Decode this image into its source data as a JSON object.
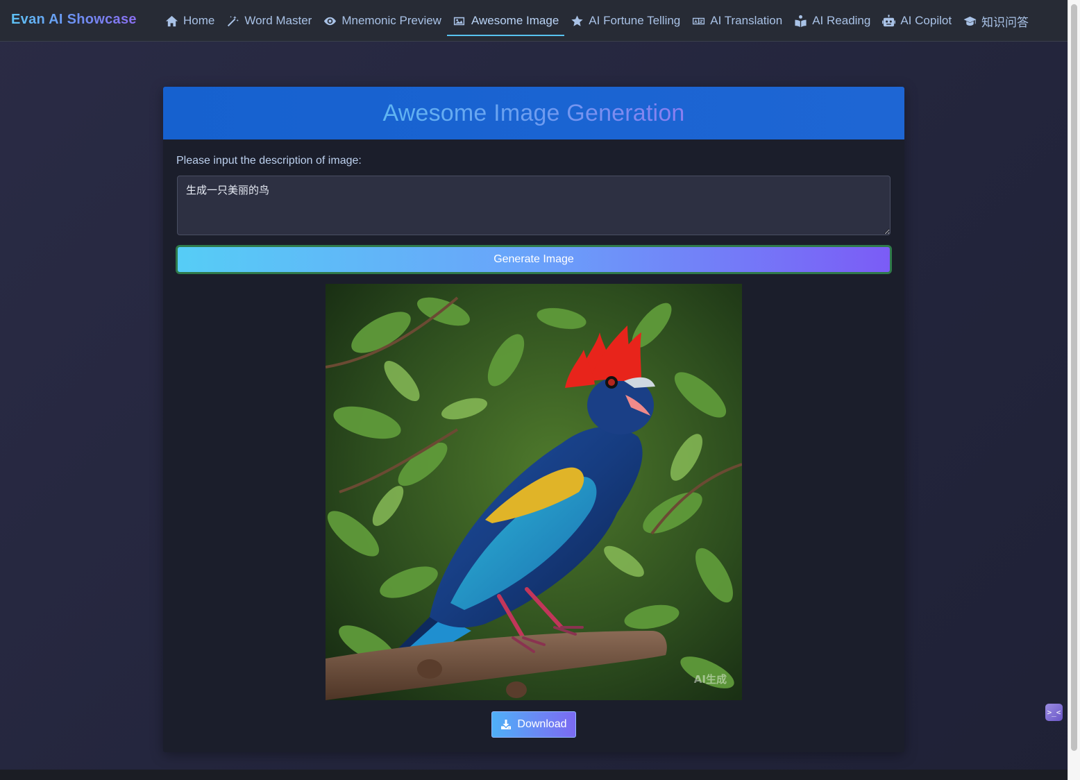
{
  "app": {
    "brand": "Evan AI Showcase"
  },
  "nav": {
    "items": [
      {
        "label": "Home",
        "icon": "home-icon",
        "active": false
      },
      {
        "label": "Word Master",
        "icon": "magic-wand-icon",
        "active": false
      },
      {
        "label": "Mnemonic Preview",
        "icon": "eye-icon",
        "active": false
      },
      {
        "label": "Awesome Image",
        "icon": "image-icon",
        "active": true
      },
      {
        "label": "AI Fortune Telling",
        "icon": "star-icon",
        "active": false
      },
      {
        "label": "AI Translation",
        "icon": "language-icon",
        "active": false
      },
      {
        "label": "AI Reading",
        "icon": "book-reader-icon",
        "active": false
      },
      {
        "label": "AI Copilot",
        "icon": "robot-icon",
        "active": false
      },
      {
        "label": "知识问答",
        "icon": "graduation-cap-icon",
        "active": false
      }
    ]
  },
  "main": {
    "title": "Awesome Image Generation",
    "description_label": "Please input the description of image:",
    "description_value": "生成一只美丽的鸟",
    "generate_button": "Generate Image",
    "result_image": {
      "subject": "colorful blue bird with red crest perched on a branch",
      "watermark": "AI生成"
    },
    "download_button": "Download",
    "download_icon": "download-icon"
  },
  "floating_widget": {
    "icon": "assistant-face-icon",
    "glyph": ">_<"
  },
  "colors": {
    "accent": "#58c3ef",
    "header": "#1a64cf",
    "button_start": "#56cdf6",
    "button_end": "#7b5cf6"
  }
}
